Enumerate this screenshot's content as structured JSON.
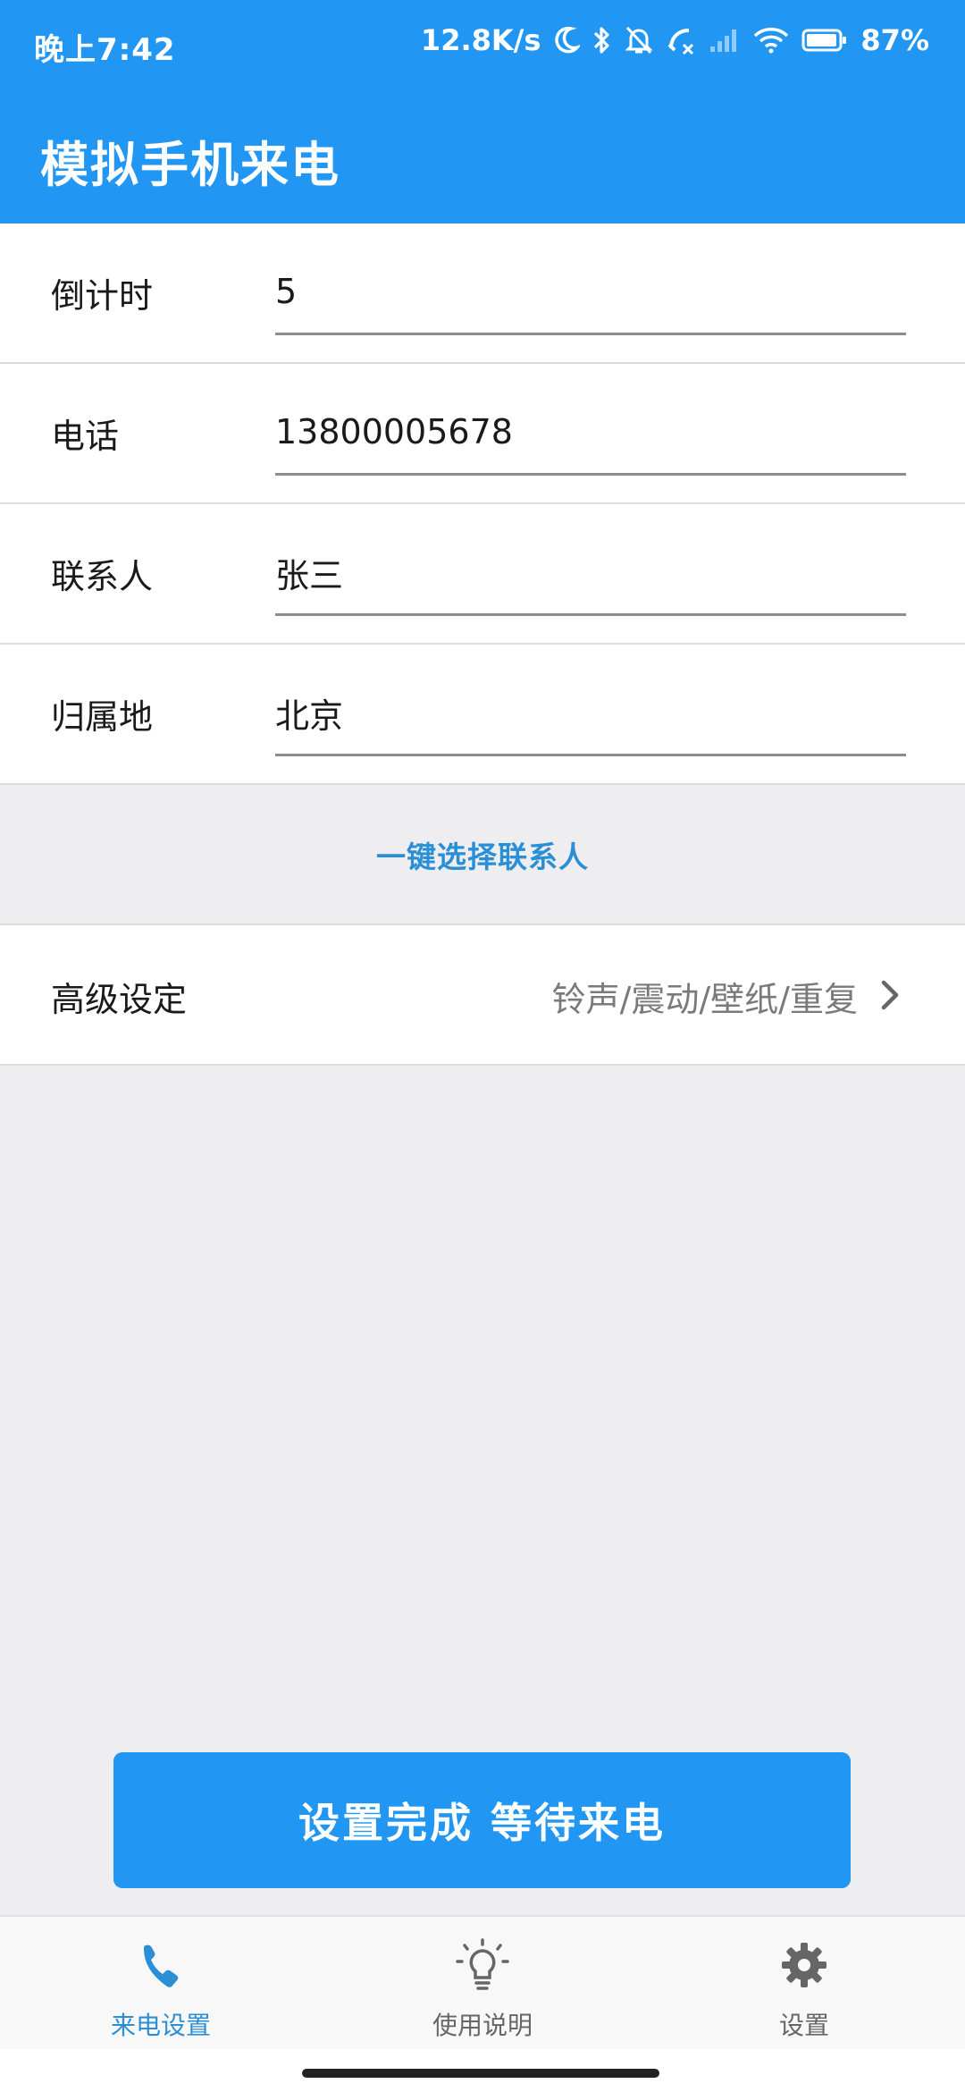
{
  "status_bar": {
    "time": "晚上7:42",
    "net_speed": "12.8K/s",
    "battery": "87%"
  },
  "app_bar": {
    "title": "模拟手机来电"
  },
  "form": {
    "rows": [
      {
        "label": "倒计时",
        "value": "5"
      },
      {
        "label": "电话",
        "value": "13800005678"
      },
      {
        "label": "联系人",
        "value": "张三"
      },
      {
        "label": "归属地",
        "value": "北京"
      }
    ],
    "pick_contact_label": "一键选择联系人",
    "advanced": {
      "label": "高级设定",
      "value": "铃声/震动/壁纸/重复"
    }
  },
  "main_button_label": "设置完成 等待来电",
  "bottom_nav": {
    "items": [
      {
        "label": "来电设置",
        "icon": "phone-icon",
        "active": true
      },
      {
        "label": "使用说明",
        "icon": "lightbulb-icon",
        "active": false
      },
      {
        "label": "设置",
        "icon": "gear-icon",
        "active": false
      }
    ]
  },
  "colors": {
    "primary": "#2196F3",
    "accent_text": "#2B8FD6",
    "background": "#EEEEF0"
  }
}
